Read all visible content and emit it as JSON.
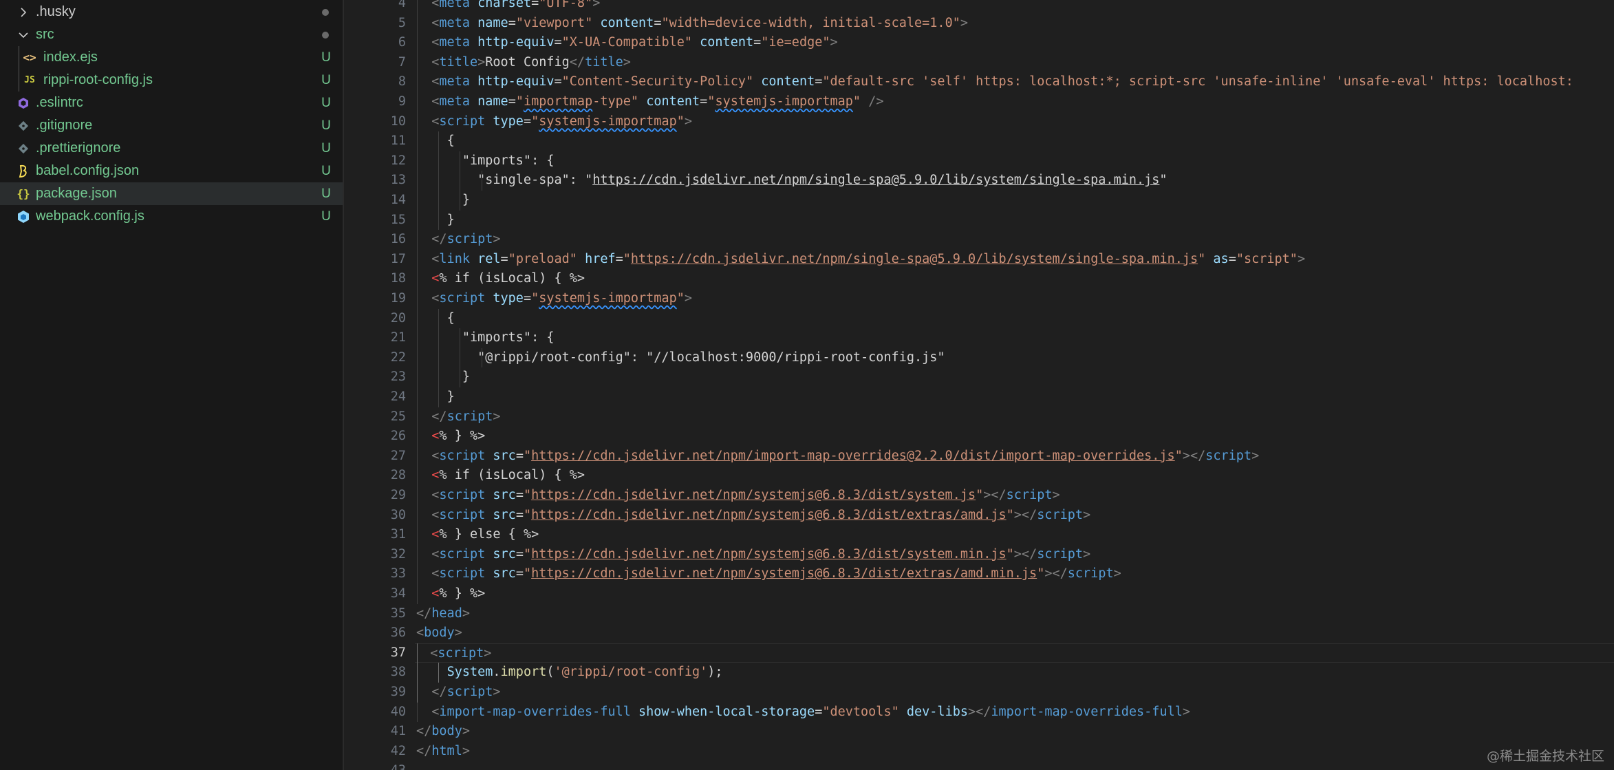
{
  "explorer": {
    "items": [
      {
        "type": "folder",
        "expanded": false,
        "name": ".husky",
        "badge": "",
        "icon": "chevron-right",
        "color": "#cccccc"
      },
      {
        "type": "folder",
        "expanded": true,
        "name": "src",
        "badge": "",
        "icon": "chevron-down",
        "color": "#73c991"
      },
      {
        "type": "file",
        "name": "index.ejs",
        "badge": "U",
        "icon": "<>",
        "icon_color": "#e8c07d",
        "color": "#73c991"
      },
      {
        "type": "file",
        "name": "rippi-root-config.js",
        "badge": "U",
        "icon": "JS",
        "icon_color": "#cbcb41",
        "color": "#73c991"
      },
      {
        "type": "file",
        "name": ".eslintrc",
        "badge": "U",
        "icon": "eslint",
        "icon_color": "#8f6ade",
        "color": "#73c991"
      },
      {
        "type": "file",
        "name": ".gitignore",
        "badge": "U",
        "icon": "git",
        "icon_color": "#6d8086",
        "color": "#73c991"
      },
      {
        "type": "file",
        "name": ".prettierignore",
        "badge": "U",
        "icon": "prettier",
        "icon_color": "#6d8086",
        "color": "#73c991"
      },
      {
        "type": "file",
        "name": "babel.config.json",
        "badge": "U",
        "icon": "babel",
        "icon_color": "#f5da55",
        "color": "#73c991"
      },
      {
        "type": "file",
        "name": "package.json",
        "badge": "U",
        "icon": "{}",
        "icon_color": "#cbcb41",
        "color": "#73c991",
        "selected": true
      },
      {
        "type": "file",
        "name": "webpack.config.js",
        "badge": "U",
        "icon": "webpack",
        "icon_color": "#519aba",
        "color": "#73c991"
      }
    ]
  },
  "editor": {
    "first_line": 4,
    "active_line": 37,
    "lines": [
      {
        "n": 4,
        "indent": 1,
        "tokens": [
          [
            "p",
            "<"
          ],
          [
            "t",
            "meta "
          ],
          [
            "a",
            "charset"
          ],
          [
            "tx",
            "="
          ],
          [
            "s",
            "\"UTF-8\""
          ],
          [
            "p",
            ">"
          ]
        ]
      },
      {
        "n": 5,
        "indent": 1,
        "tokens": [
          [
            "p",
            "<"
          ],
          [
            "t",
            "meta "
          ],
          [
            "a",
            "name"
          ],
          [
            "tx",
            "="
          ],
          [
            "s",
            "\"viewport\" "
          ],
          [
            "a",
            "content"
          ],
          [
            "tx",
            "="
          ],
          [
            "s",
            "\"width=device-width, initial-scale=1.0\""
          ],
          [
            "p",
            ">"
          ]
        ]
      },
      {
        "n": 6,
        "indent": 1,
        "tokens": [
          [
            "p",
            "<"
          ],
          [
            "t",
            "meta "
          ],
          [
            "a",
            "http-equiv"
          ],
          [
            "tx",
            "="
          ],
          [
            "s",
            "\"X-UA-Compatible\" "
          ],
          [
            "a",
            "content"
          ],
          [
            "tx",
            "="
          ],
          [
            "s",
            "\"ie=edge\""
          ],
          [
            "p",
            ">"
          ]
        ]
      },
      {
        "n": 7,
        "indent": 1,
        "tokens": [
          [
            "p",
            "<"
          ],
          [
            "t",
            "title"
          ],
          [
            "p",
            ">"
          ],
          [
            "tx",
            "Root Config"
          ],
          [
            "p",
            "</"
          ],
          [
            "t",
            "title"
          ],
          [
            "p",
            ">"
          ]
        ]
      },
      {
        "n": 8,
        "indent": 1,
        "tokens": [
          [
            "p",
            "<"
          ],
          [
            "t",
            "meta "
          ],
          [
            "a",
            "http-equiv"
          ],
          [
            "tx",
            "="
          ],
          [
            "s",
            "\"Content-Security-Policy\" "
          ],
          [
            "a",
            "content"
          ],
          [
            "tx",
            "="
          ],
          [
            "s",
            "\"default-src 'self' https: localhost:*; script-src 'unsafe-inline' 'unsafe-eval' https: localhost:"
          ]
        ]
      },
      {
        "n": 9,
        "indent": 1,
        "tokens": [
          [
            "p",
            "<"
          ],
          [
            "t",
            "meta "
          ],
          [
            "a",
            "name"
          ],
          [
            "tx",
            "="
          ],
          [
            "s",
            "\""
          ],
          [
            "s sq",
            "importmap"
          ],
          [
            "s",
            "-type\" "
          ],
          [
            "a",
            "content"
          ],
          [
            "tx",
            "="
          ],
          [
            "s",
            "\""
          ],
          [
            "s sq",
            "systemjs-importmap"
          ],
          [
            "s",
            "\" "
          ],
          [
            "p",
            "/>"
          ]
        ]
      },
      {
        "n": 10,
        "indent": 1,
        "tokens": [
          [
            "p",
            "<"
          ],
          [
            "t",
            "script "
          ],
          [
            "a",
            "type"
          ],
          [
            "tx",
            "="
          ],
          [
            "s",
            "\""
          ],
          [
            "s sq",
            "systemjs-importmap"
          ],
          [
            "s",
            "\""
          ],
          [
            "p",
            ">"
          ]
        ]
      },
      {
        "n": 11,
        "indent": 2,
        "tokens": [
          [
            "tx",
            "{"
          ]
        ]
      },
      {
        "n": 12,
        "indent": 3,
        "tokens": [
          [
            "tx",
            "\"imports\": {"
          ]
        ]
      },
      {
        "n": 13,
        "indent": 4,
        "tokens": [
          [
            "tx",
            "\"single-spa\": \""
          ],
          [
            "tx ul",
            "https://cdn.jsdelivr.net/npm/single-spa@5.9.0/lib/system/single-spa.min.js"
          ],
          [
            "tx",
            "\""
          ]
        ]
      },
      {
        "n": 14,
        "indent": 3,
        "tokens": [
          [
            "tx",
            "}"
          ]
        ]
      },
      {
        "n": 15,
        "indent": 2,
        "tokens": [
          [
            "tx",
            "}"
          ]
        ]
      },
      {
        "n": 16,
        "indent": 1,
        "tokens": [
          [
            "p",
            "</"
          ],
          [
            "t",
            "script"
          ],
          [
            "p",
            ">"
          ]
        ]
      },
      {
        "n": 17,
        "indent": 1,
        "tokens": [
          [
            "p",
            "<"
          ],
          [
            "t",
            "link "
          ],
          [
            "a",
            "rel"
          ],
          [
            "tx",
            "="
          ],
          [
            "s",
            "\"preload\" "
          ],
          [
            "a",
            "href"
          ],
          [
            "tx",
            "="
          ],
          [
            "s",
            "\""
          ],
          [
            "u",
            "https://cdn.jsdelivr.net/npm/single-spa@5.9.0/lib/system/single-spa.min.js"
          ],
          [
            "s",
            "\" "
          ],
          [
            "a",
            "as"
          ],
          [
            "tx",
            "="
          ],
          [
            "s",
            "\"script\""
          ],
          [
            "p",
            ">"
          ]
        ]
      },
      {
        "n": 18,
        "indent": 1,
        "tokens": [
          [
            "ejs",
            "<"
          ],
          [
            "tx",
            "% if (isLocal) { %>"
          ]
        ]
      },
      {
        "n": 19,
        "indent": 1,
        "tokens": [
          [
            "p",
            "<"
          ],
          [
            "t",
            "script "
          ],
          [
            "a",
            "type"
          ],
          [
            "tx",
            "="
          ],
          [
            "s",
            "\""
          ],
          [
            "s sq",
            "systemjs-importmap"
          ],
          [
            "s",
            "\""
          ],
          [
            "p",
            ">"
          ]
        ]
      },
      {
        "n": 20,
        "indent": 2,
        "tokens": [
          [
            "tx",
            "{"
          ]
        ]
      },
      {
        "n": 21,
        "indent": 3,
        "tokens": [
          [
            "tx",
            "\"imports\": {"
          ]
        ]
      },
      {
        "n": 22,
        "indent": 4,
        "tokens": [
          [
            "tx",
            "\"@rippi/root-config\": \"//localhost:9000/rippi-root-config.js\""
          ]
        ]
      },
      {
        "n": 23,
        "indent": 3,
        "tokens": [
          [
            "tx",
            "}"
          ]
        ]
      },
      {
        "n": 24,
        "indent": 2,
        "tokens": [
          [
            "tx",
            "}"
          ]
        ]
      },
      {
        "n": 25,
        "indent": 1,
        "tokens": [
          [
            "p",
            "</"
          ],
          [
            "t",
            "script"
          ],
          [
            "p",
            ">"
          ]
        ]
      },
      {
        "n": 26,
        "indent": 1,
        "tokens": [
          [
            "ejs",
            "<"
          ],
          [
            "tx",
            "% } %>"
          ]
        ]
      },
      {
        "n": 27,
        "indent": 1,
        "tokens": [
          [
            "p",
            "<"
          ],
          [
            "t",
            "script "
          ],
          [
            "a",
            "src"
          ],
          [
            "tx",
            "="
          ],
          [
            "s",
            "\""
          ],
          [
            "u",
            "https://cdn.jsdelivr.net/npm/import-map-overrides@2.2.0/dist/import-map-overrides.js"
          ],
          [
            "s",
            "\""
          ],
          [
            "p",
            "></"
          ],
          [
            "t",
            "script"
          ],
          [
            "p",
            ">"
          ]
        ]
      },
      {
        "n": 28,
        "indent": 1,
        "tokens": [
          [
            "ejs",
            "<"
          ],
          [
            "tx",
            "% if (isLocal) { %>"
          ]
        ]
      },
      {
        "n": 29,
        "indent": 1,
        "tokens": [
          [
            "p",
            "<"
          ],
          [
            "t",
            "script "
          ],
          [
            "a",
            "src"
          ],
          [
            "tx",
            "="
          ],
          [
            "s",
            "\""
          ],
          [
            "u",
            "https://cdn.jsdelivr.net/npm/systemjs@6.8.3/dist/system.js"
          ],
          [
            "s",
            "\""
          ],
          [
            "p",
            "></"
          ],
          [
            "t",
            "script"
          ],
          [
            "p",
            ">"
          ]
        ]
      },
      {
        "n": 30,
        "indent": 1,
        "tokens": [
          [
            "p",
            "<"
          ],
          [
            "t",
            "script "
          ],
          [
            "a",
            "src"
          ],
          [
            "tx",
            "="
          ],
          [
            "s",
            "\""
          ],
          [
            "u",
            "https://cdn.jsdelivr.net/npm/systemjs@6.8.3/dist/extras/amd.js"
          ],
          [
            "s",
            "\""
          ],
          [
            "p",
            "></"
          ],
          [
            "t",
            "script"
          ],
          [
            "p",
            ">"
          ]
        ]
      },
      {
        "n": 31,
        "indent": 1,
        "tokens": [
          [
            "ejs",
            "<"
          ],
          [
            "tx",
            "% } else { %>"
          ]
        ]
      },
      {
        "n": 32,
        "indent": 1,
        "tokens": [
          [
            "p",
            "<"
          ],
          [
            "t",
            "script "
          ],
          [
            "a",
            "src"
          ],
          [
            "tx",
            "="
          ],
          [
            "s",
            "\""
          ],
          [
            "u",
            "https://cdn.jsdelivr.net/npm/systemjs@6.8.3/dist/system.min.js"
          ],
          [
            "s",
            "\""
          ],
          [
            "p",
            "></"
          ],
          [
            "t",
            "script"
          ],
          [
            "p",
            ">"
          ]
        ]
      },
      {
        "n": 33,
        "indent": 1,
        "tokens": [
          [
            "p",
            "<"
          ],
          [
            "t",
            "script "
          ],
          [
            "a",
            "src"
          ],
          [
            "tx",
            "="
          ],
          [
            "s",
            "\""
          ],
          [
            "u",
            "https://cdn.jsdelivr.net/npm/systemjs@6.8.3/dist/extras/amd.min.js"
          ],
          [
            "s",
            "\""
          ],
          [
            "p",
            "></"
          ],
          [
            "t",
            "script"
          ],
          [
            "p",
            ">"
          ]
        ]
      },
      {
        "n": 34,
        "indent": 1,
        "tokens": [
          [
            "ejs",
            "<"
          ],
          [
            "tx",
            "% } %>"
          ]
        ]
      },
      {
        "n": 35,
        "indent": 0,
        "tokens": [
          [
            "p",
            "</"
          ],
          [
            "t",
            "head"
          ],
          [
            "p",
            ">"
          ]
        ]
      },
      {
        "n": 36,
        "indent": 0,
        "tokens": [
          [
            "p",
            "<"
          ],
          [
            "t",
            "body"
          ],
          [
            "p",
            ">"
          ]
        ]
      },
      {
        "n": 37,
        "indent": 1,
        "tokens": [
          [
            "p",
            "<"
          ],
          [
            "t",
            "script"
          ],
          [
            "p",
            ">"
          ]
        ]
      },
      {
        "n": 38,
        "indent": 2,
        "tokens": [
          [
            "var",
            "System"
          ],
          [
            "tx",
            "."
          ],
          [
            "fn",
            "import"
          ],
          [
            "tx",
            "("
          ],
          [
            "s",
            "'@rippi/root-config'"
          ],
          [
            "tx",
            ");"
          ]
        ]
      },
      {
        "n": 39,
        "indent": 1,
        "tokens": [
          [
            "p",
            "</"
          ],
          [
            "t",
            "script"
          ],
          [
            "p",
            ">"
          ]
        ]
      },
      {
        "n": 40,
        "indent": 1,
        "tokens": [
          [
            "p",
            "<"
          ],
          [
            "t",
            "import-map-overrides-full "
          ],
          [
            "a",
            "show-when-local-storage"
          ],
          [
            "tx",
            "="
          ],
          [
            "s",
            "\"devtools\" "
          ],
          [
            "a",
            "dev-libs"
          ],
          [
            "p",
            "></"
          ],
          [
            "t",
            "import-map-overrides-full"
          ],
          [
            "p",
            ">"
          ]
        ]
      },
      {
        "n": 41,
        "indent": 0,
        "tokens": [
          [
            "p",
            "</"
          ],
          [
            "t",
            "body"
          ],
          [
            "p",
            ">"
          ]
        ]
      },
      {
        "n": 42,
        "indent": 0,
        "tokens": [
          [
            "p",
            "</"
          ],
          [
            "t",
            "html"
          ],
          [
            "p",
            ">"
          ]
        ]
      },
      {
        "n": 43,
        "indent": 0,
        "tokens": []
      }
    ]
  },
  "watermark": "@稀土掘金技术社区"
}
